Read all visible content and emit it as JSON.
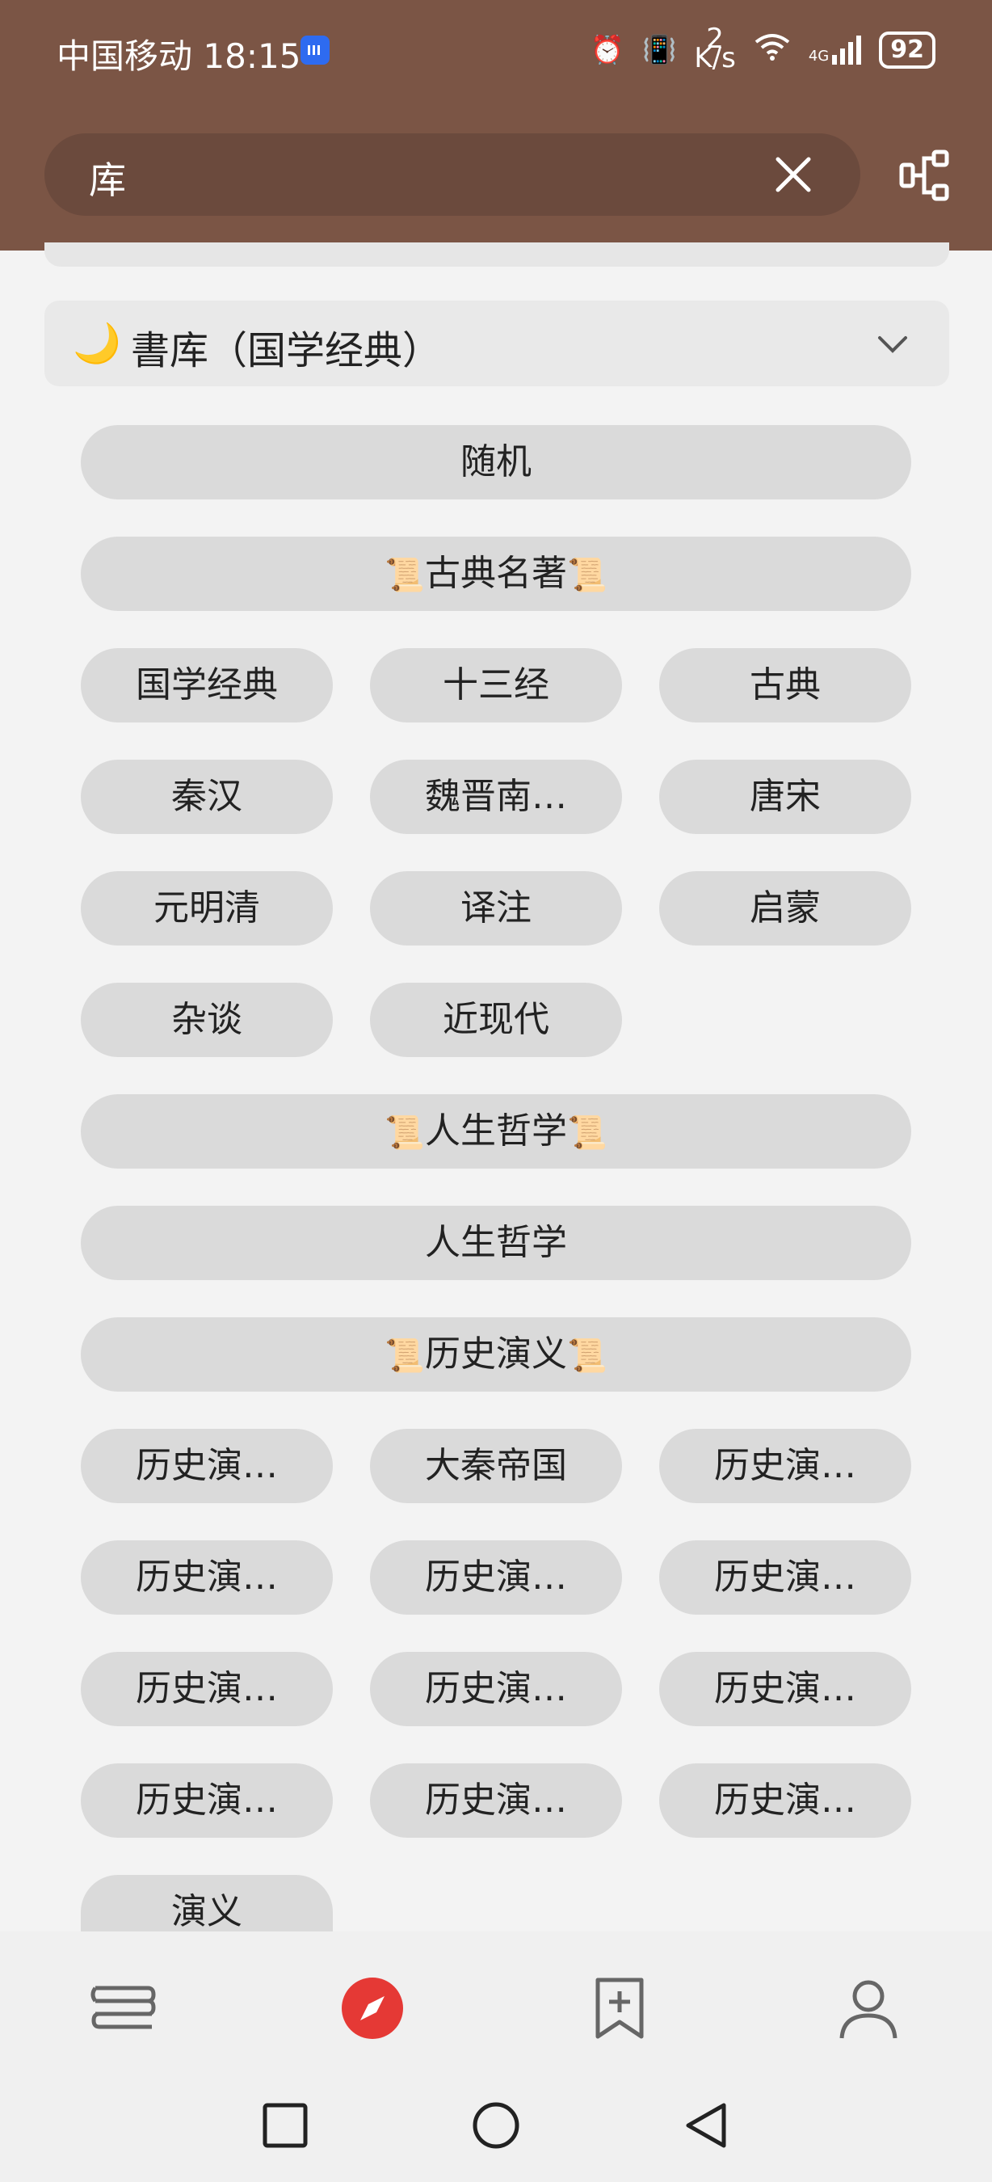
{
  "status_bar": {
    "carrier": "中国移动",
    "time": "18:15",
    "net_speed_value": "2",
    "net_speed_unit": "K/s",
    "signal_type": "4G",
    "battery": "92"
  },
  "search": {
    "query": "库"
  },
  "section": {
    "title": "書库（国学经典）"
  },
  "tags": {
    "random": "随机",
    "classics_header": "古典名著",
    "row1": [
      "国学经典",
      "十三经",
      "古典"
    ],
    "row2": [
      "秦汉",
      "魏晋南…",
      "唐宋"
    ],
    "row3": [
      "元明清",
      "译注",
      "启蒙"
    ],
    "row4": [
      "杂谈",
      "近现代"
    ],
    "philosophy_header": "人生哲学",
    "philosophy": "人生哲学",
    "history_header": "历史演义",
    "row5": [
      "历史演…",
      "大秦帝国",
      "历史演…"
    ],
    "row6": [
      "历史演…",
      "历史演…",
      "历史演…"
    ],
    "row7": [
      "历史演…",
      "历史演…",
      "历史演…"
    ],
    "row8": [
      "历史演…",
      "历史演…",
      "历史演…"
    ],
    "row9": [
      "演义"
    ]
  },
  "icons": {
    "scroll": "scroll-emoji",
    "moon": "crescent-moon-emoji"
  },
  "colors": {
    "header_bg": "#7b5545",
    "accent": "#e53935",
    "tag_bg": "#dadada"
  }
}
